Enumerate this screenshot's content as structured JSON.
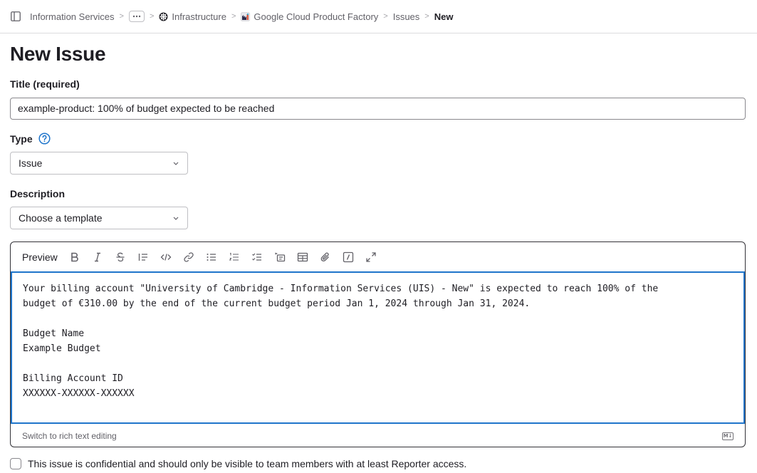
{
  "breadcrumb": {
    "items": [
      {
        "label": "Information Services"
      },
      {
        "label": "Infrastructure",
        "icon": "group-avatar-icon"
      },
      {
        "label": "Google Cloud Product Factory",
        "icon": "project-avatar-icon"
      },
      {
        "label": "Issues"
      },
      {
        "label": "New"
      }
    ],
    "more_icon": "ellipsis-icon",
    "sidebar_toggle_icon": "sidebar-icon"
  },
  "page": {
    "title": "New Issue"
  },
  "form": {
    "title_label": "Title (required)",
    "title_value": "example-product: 100% of budget expected to be reached",
    "type_label": "Type",
    "type_value": "Issue",
    "description_label": "Description",
    "template_value": "Choose a template",
    "editor": {
      "preview_label": "Preview",
      "toolbar_icons": [
        "bold-icon",
        "italic-icon",
        "strikethrough-icon",
        "quote-icon",
        "code-icon",
        "link-icon",
        "bulleted-list-icon",
        "numbered-list-icon",
        "task-list-icon",
        "collapsible-section-icon",
        "table-icon",
        "attach-file-icon",
        "quick-actions-icon",
        "fullscreen-icon"
      ],
      "content": "Your billing account \"University of Cambridge - Information Services (UIS) - New\" is expected to reach 100% of the\nbudget of €310.00 by the end of the current budget period Jan 1, 2024 through Jan 31, 2024.\n\nBudget Name\nExample Budget\n\nBilling Account ID\nXXXXXX-XXXXXX-XXXXXX",
      "switch_label": "Switch to rich text editing",
      "markdown_badge": "M↓"
    },
    "confidential_label": "This issue is confidential and should only be visible to team members with at least Reporter access.",
    "confidential_checked": false
  },
  "colors": {
    "accent": "#1f75cb",
    "text": "#1f1e24",
    "muted": "#626168"
  }
}
